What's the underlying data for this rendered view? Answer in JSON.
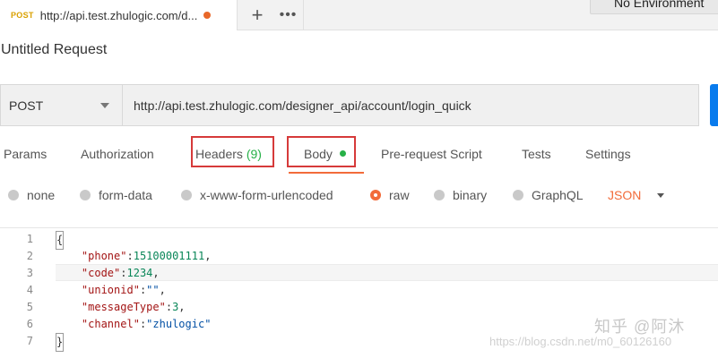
{
  "tab": {
    "method": "POST",
    "url": "http://api.test.zhulogic.com/d...",
    "plus": "+",
    "more": "•••"
  },
  "environment": "No Environment",
  "request_title": "Untitled Request",
  "request": {
    "method": "POST",
    "url": "http://api.test.zhulogic.com/designer_api/account/login_quick"
  },
  "option_tabs": {
    "params": "Params",
    "authorization": "Authorization",
    "headers": "Headers",
    "headers_count": "(9)",
    "body": "Body",
    "prerequest": "Pre-request Script",
    "tests": "Tests",
    "settings": "Settings"
  },
  "body_types": {
    "none": "none",
    "form_data": "form-data",
    "urlencoded": "x-www-form-urlencoded",
    "raw": "raw",
    "binary": "binary",
    "graphql": "GraphQL",
    "format": "JSON",
    "selected": "raw"
  },
  "code_lines": {
    "l1": {
      "n": "1",
      "open": "{"
    },
    "l2": {
      "n": "2",
      "key": "\"phone\"",
      "sep": ":",
      "val": "15100001111",
      "end": ","
    },
    "l3": {
      "n": "3",
      "key": "\"code\"",
      "sep": ":",
      "val": "1234",
      "end": ","
    },
    "l4": {
      "n": "4",
      "key": "\"unionid\"",
      "sep": ":",
      "val": "\"\"",
      "end": ","
    },
    "l5": {
      "n": "5",
      "key": "\"messageType\"",
      "sep": ":",
      "val": "3",
      "end": ","
    },
    "l6": {
      "n": "6",
      "key": "\"channel\"",
      "sep": ":",
      "val": "\"zhulogic\"",
      "end": ""
    },
    "l7": {
      "n": "7",
      "close": "}"
    }
  },
  "watermarks": {
    "zhihu": "知乎 @阿沐",
    "csdn": "https://blog.csdn.net/m0_60126160"
  },
  "colors": {
    "accent": "#f26b3a",
    "highlight_box": "#d63a3a",
    "status_green": "#26b047",
    "send_blue": "#097bed"
  }
}
